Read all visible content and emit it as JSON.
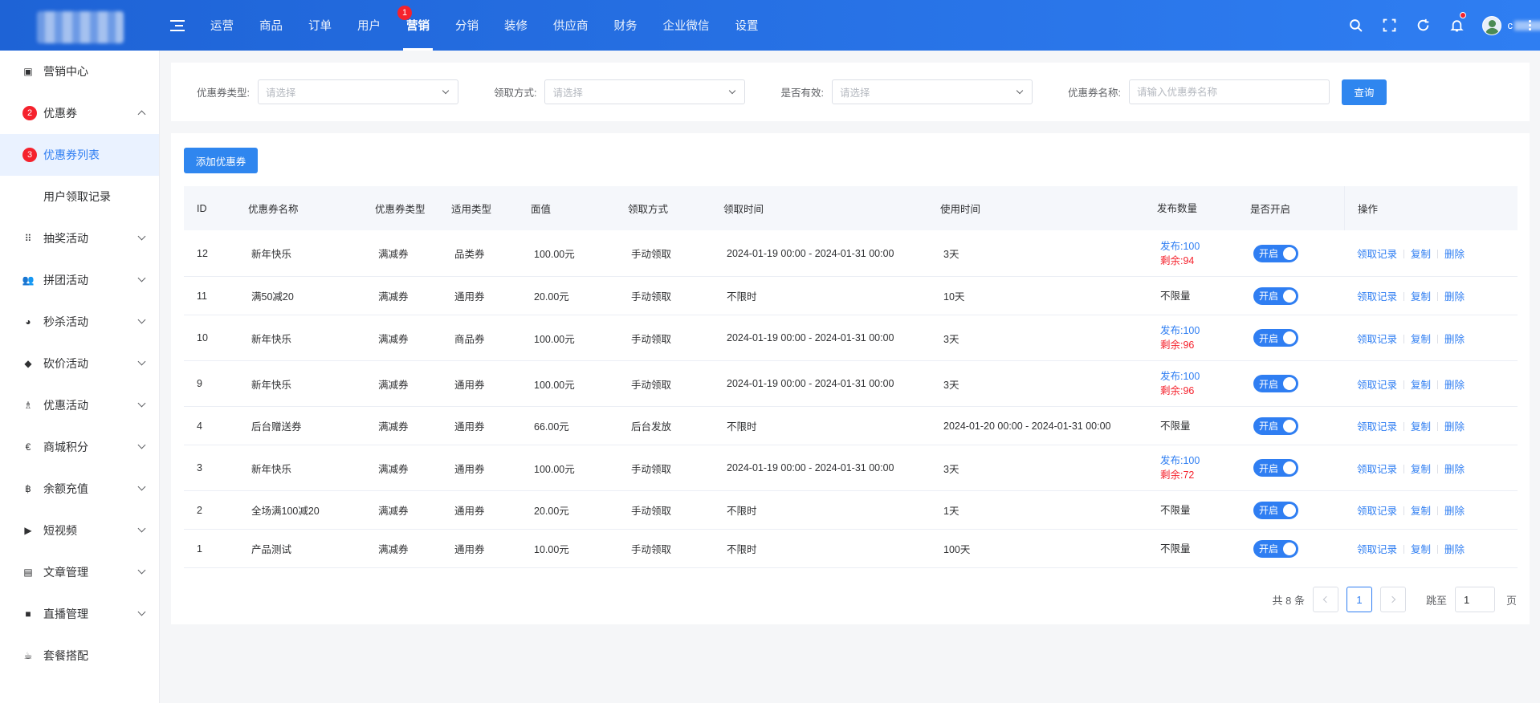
{
  "topbar": {
    "nav": [
      {
        "label": "运营"
      },
      {
        "label": "商品"
      },
      {
        "label": "订单"
      },
      {
        "label": "用户"
      },
      {
        "label": "营销",
        "badge": "1",
        "active": true
      },
      {
        "label": "分销"
      },
      {
        "label": "装修"
      },
      {
        "label": "供应商"
      },
      {
        "label": "财务"
      },
      {
        "label": "企业微信"
      },
      {
        "label": "设置"
      }
    ],
    "user_initial": "c",
    "tools": [
      "search-icon",
      "fullscreen-icon",
      "refresh-icon",
      "bell-icon"
    ]
  },
  "sidebar": {
    "items": [
      {
        "label": "营销中心",
        "icon": "▣"
      },
      {
        "label": "优惠券",
        "badge": "2",
        "expanded": true
      },
      {
        "label": "优惠券列表",
        "badge": "3",
        "active": true,
        "sub": true
      },
      {
        "label": "用户领取记录",
        "sub": true
      },
      {
        "label": "抽奖活动",
        "icon": "⠿",
        "chevron": true
      },
      {
        "label": "拼团活动",
        "icon": "👥",
        "chevron": true
      },
      {
        "label": "秒杀活动",
        "icon": "◕",
        "chevron": true
      },
      {
        "label": "砍价活动",
        "icon": "◆",
        "chevron": true
      },
      {
        "label": "优惠活动",
        "icon": "♗",
        "chevron": true
      },
      {
        "label": "商城积分",
        "icon": "€",
        "chevron": true
      },
      {
        "label": "余额充值",
        "icon": "฿",
        "chevron": true
      },
      {
        "label": "短视频",
        "icon": "▶",
        "chevron": true
      },
      {
        "label": "文章管理",
        "icon": "▤",
        "chevron": true
      },
      {
        "label": "直播管理",
        "icon": "■",
        "chevron": true
      },
      {
        "label": "套餐搭配",
        "icon": "☕"
      }
    ]
  },
  "filter": {
    "type_label": "优惠券类型:",
    "type_placeholder": "请选择",
    "method_label": "领取方式:",
    "method_placeholder": "请选择",
    "valid_label": "是否有效:",
    "valid_placeholder": "请选择",
    "name_label": "优惠券名称:",
    "name_placeholder": "请输入优惠券名称",
    "query_label": "查询"
  },
  "main": {
    "add_label": "添加优惠券",
    "columns": [
      "ID",
      "优惠券名称",
      "优惠券类型",
      "适用类型",
      "面值",
      "领取方式",
      "领取时间",
      "使用时间",
      "发布数量",
      "是否开启",
      "操作"
    ],
    "publish_prefix": "发布:",
    "remain_prefix": "剩余:",
    "rows": [
      {
        "id": "12",
        "name": "新年快乐",
        "type": "满减券",
        "apply": "品类券",
        "value": "100.00元",
        "method": "手动领取",
        "get_time": "2024-01-19 00:00 - 2024-01-31 00:00",
        "use_time": "3天",
        "published": "100",
        "remaining": "94",
        "unlimited": "",
        "switch": "开启",
        "h": 58
      },
      {
        "id": "11",
        "name": "满50减20",
        "type": "满减券",
        "apply": "通用券",
        "value": "20.00元",
        "method": "手动领取",
        "get_time": "不限时",
        "use_time": "10天",
        "published": "",
        "remaining": "",
        "unlimited": "不限量",
        "switch": "开启",
        "h": 48
      },
      {
        "id": "10",
        "name": "新年快乐",
        "type": "满减券",
        "apply": "商品券",
        "value": "100.00元",
        "method": "手动领取",
        "get_time": "2024-01-19 00:00 - 2024-01-31 00:00",
        "use_time": "3天",
        "published": "100",
        "remaining": "96",
        "unlimited": "",
        "switch": "开启",
        "h": 57
      },
      {
        "id": "9",
        "name": "新年快乐",
        "type": "满减券",
        "apply": "通用券",
        "value": "100.00元",
        "method": "手动领取",
        "get_time": "2024-01-19 00:00 - 2024-01-31 00:00",
        "use_time": "3天",
        "published": "100",
        "remaining": "96",
        "unlimited": "",
        "switch": "开启",
        "h": 57
      },
      {
        "id": "4",
        "name": "后台赠送券",
        "type": "满减券",
        "apply": "通用券",
        "value": "66.00元",
        "method": "后台发放",
        "get_time": "不限时",
        "use_time": "2024-01-20 00:00 - 2024-01-31 00:00",
        "published": "",
        "remaining": "",
        "unlimited": "不限量",
        "switch": "开启",
        "h": 48
      },
      {
        "id": "3",
        "name": "新年快乐",
        "type": "满减券",
        "apply": "通用券",
        "value": "100.00元",
        "method": "手动领取",
        "get_time": "2024-01-19 00:00 - 2024-01-31 00:00",
        "use_time": "3天",
        "published": "100",
        "remaining": "72",
        "unlimited": "",
        "switch": "开启",
        "h": 57
      },
      {
        "id": "2",
        "name": "全场满100减20",
        "type": "满减券",
        "apply": "通用券",
        "value": "20.00元",
        "method": "手动领取",
        "get_time": "不限时",
        "use_time": "1天",
        "published": "",
        "remaining": "",
        "unlimited": "不限量",
        "switch": "开启",
        "h": 48
      },
      {
        "id": "1",
        "name": "产品测试",
        "type": "满减券",
        "apply": "通用券",
        "value": "10.00元",
        "method": "手动领取",
        "get_time": "不限时",
        "use_time": "100天",
        "published": "",
        "remaining": "",
        "unlimited": "不限量",
        "switch": "开启",
        "h": 48
      }
    ],
    "ops": [
      "领取记录",
      "复制",
      "删除"
    ]
  },
  "pagination": {
    "total_label": "共 8 条",
    "current_page": "1",
    "jump_label": "跳至",
    "jump_value": "1",
    "page_unit": "页"
  }
}
